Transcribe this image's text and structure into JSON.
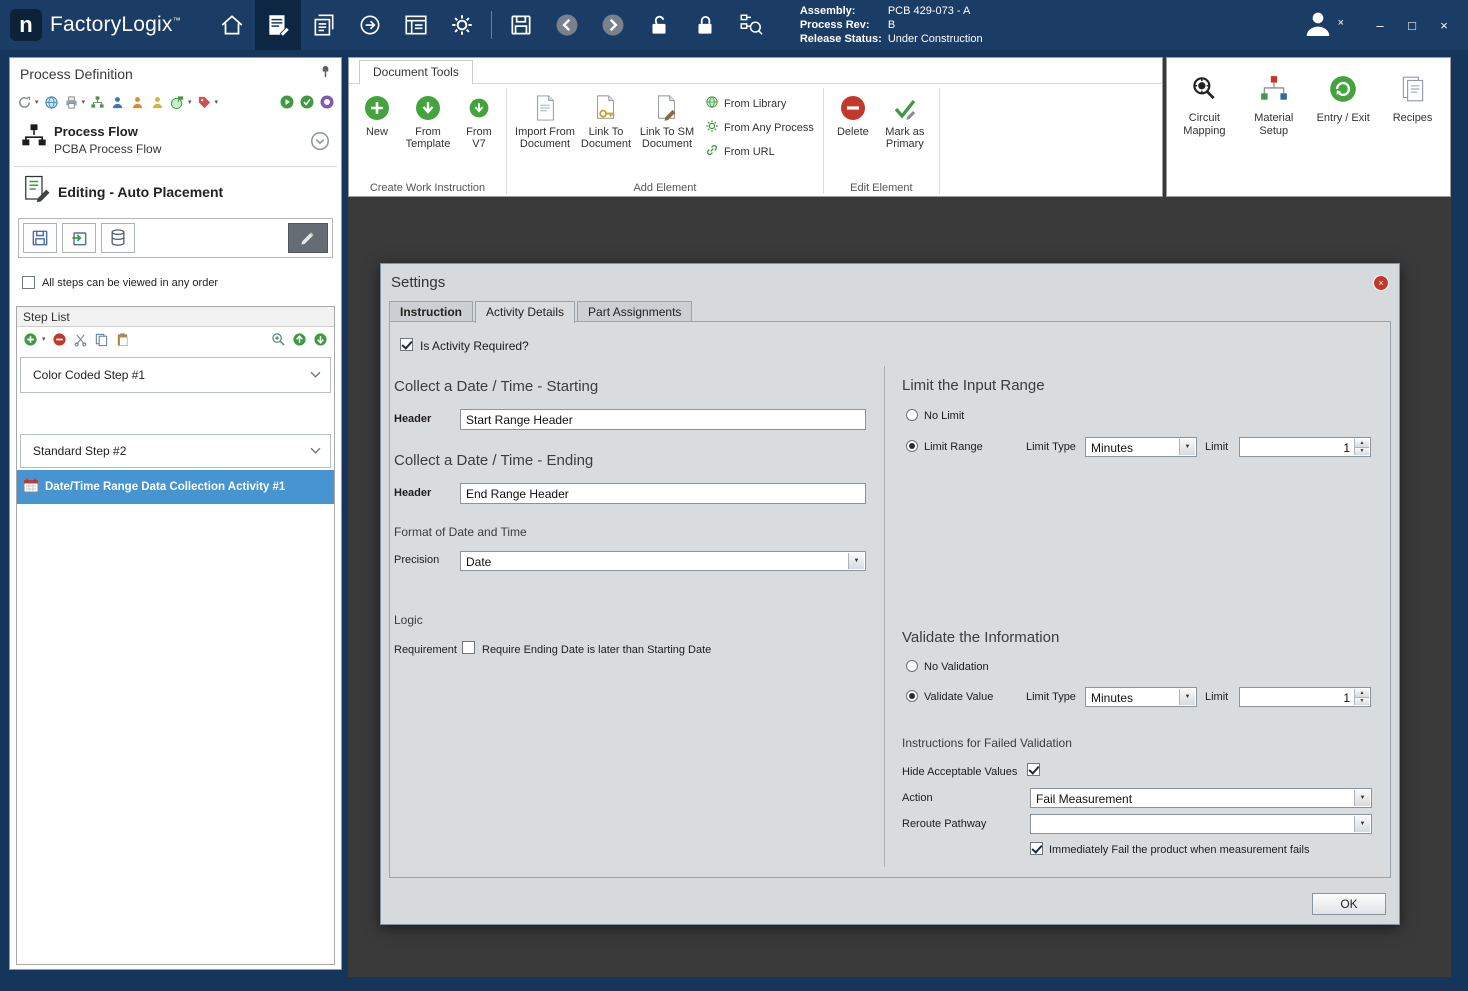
{
  "glyphs": {
    "tm": "™",
    "caret": "▾",
    "dropdown": "▼",
    "spin_up": "▲",
    "spin_down": "▼",
    "minimize": "–",
    "maximize": "□",
    "close": "×",
    "user_x": "×"
  },
  "titlebar": {
    "app_name": "FactoryLogix",
    "assembly_label": "Assembly:",
    "assembly_value": "PCB 429-073 - A",
    "process_rev_label": "Process Rev:",
    "process_rev_value": "B",
    "release_status_label": "Release Status:",
    "release_status_value": "Under Construction"
  },
  "left_panel": {
    "title": "Process Definition",
    "process_flow_title": "Process Flow",
    "process_flow_subtitle": "PCBA Process Flow",
    "editing_label": "Editing - Auto Placement",
    "order_checkbox_label": "All steps can be viewed in any order",
    "order_checkbox_checked": false,
    "step_list_title": "Step List",
    "steps": [
      {
        "label": "Color Coded Step #1"
      },
      {
        "label": "Standard Step #2"
      }
    ],
    "selected_activity": "Date/Time Range Data Collection Activity #1"
  },
  "ribbon": {
    "tab_label": "Document Tools",
    "create_group": {
      "label": "Create Work Instruction",
      "new": "New",
      "from_template": "From Template",
      "from_v7": "From V7"
    },
    "add_group": {
      "label": "Add Element",
      "import_from_document": "Import From Document",
      "link_to_document": "Link To Document",
      "link_to_sm_document": "Link To SM Document",
      "from_library": "From Library",
      "from_any_process": "From Any Process",
      "from_url": "From URL"
    },
    "edit_group": {
      "label": "Edit Element",
      "delete": "Delete",
      "mark_as_primary": "Mark as Primary"
    },
    "right_buttons": [
      {
        "label": "Circuit Mapping"
      },
      {
        "label": "Material Setup"
      },
      {
        "label": "Entry / Exit"
      },
      {
        "label": "Recipes"
      }
    ]
  },
  "dialog": {
    "title": "Settings",
    "tabs": [
      {
        "label": "Instruction"
      },
      {
        "label": "Activity Details"
      },
      {
        "label": "Part Assignments"
      }
    ],
    "is_activity_required_label": "Is Activity Required?",
    "is_activity_required_checked": true,
    "starting": {
      "heading": "Collect a Date / Time - Starting",
      "header_label": "Header",
      "header_value": "Start Range Header"
    },
    "ending": {
      "heading": "Collect a Date / Time - Ending",
      "header_label": "Header",
      "header_value": "End Range Header"
    },
    "format": {
      "heading": "Format of Date and Time",
      "precision_label": "Precision",
      "precision_value": "Date"
    },
    "logic": {
      "heading": "Logic",
      "requirement_label": "Requirement",
      "requirement_checkbox_label": "Require Ending Date is later than Starting Date",
      "requirement_checked": false
    },
    "limit": {
      "heading": "Limit the Input Range",
      "no_limit_label": "No Limit",
      "no_limit_selected": false,
      "limit_range_label": "Limit Range",
      "limit_range_selected": true,
      "limit_type_label": "Limit Type",
      "limit_type_value": "Minutes",
      "limit_label": "Limit",
      "limit_value": "1"
    },
    "validate": {
      "heading": "Validate the Information",
      "no_validation_label": "No Validation",
      "no_validation_selected": false,
      "validate_value_label": "Validate Value",
      "validate_value_selected": true,
      "limit_type_label": "Limit Type",
      "limit_type_value": "Minutes",
      "limit_label": "Limit",
      "limit_value": "1"
    },
    "failed": {
      "heading": "Instructions for Failed Validation",
      "hide_acceptable_label": "Hide Acceptable Values",
      "hide_acceptable_checked": true,
      "action_label": "Action",
      "action_value": "Fail Measurement",
      "reroute_label": "Reroute Pathway",
      "reroute_value": "",
      "immediately_fail_label": "Immediately Fail the product when measurement fails",
      "immediately_fail_checked": true
    },
    "ok_label": "OK"
  }
}
